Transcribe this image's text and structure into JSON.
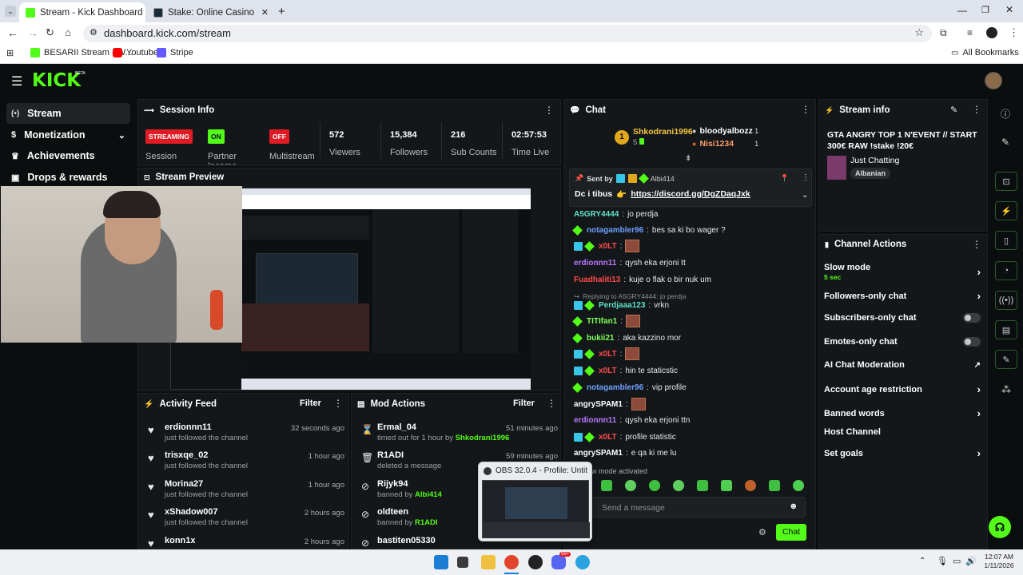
{
  "browser": {
    "tabs": [
      {
        "label": "Stream - Kick Dashboard",
        "active": true
      },
      {
        "label": "Stake: Online Casino & Sports",
        "active": false
      }
    ],
    "url": "dashboard.kick.com/stream",
    "bookmarks": [
      "BESARII Stream - W...",
      "Youtube",
      "Stripe"
    ],
    "all_bookmarks": "All Bookmarks"
  },
  "kick": {
    "logo": "KICK",
    "logo_beta": "BETA",
    "sidebar": [
      {
        "label": "Stream",
        "icon": "broadcast-icon"
      },
      {
        "label": "Monetization",
        "icon": "dollar-icon"
      },
      {
        "label": "Achievements",
        "icon": "trophy-icon"
      },
      {
        "label": "Drops & rewards",
        "icon": "gift-icon"
      }
    ],
    "session": {
      "title": "Session Info",
      "streaming_badge": "STREAMING",
      "session_label": "Session",
      "partner_badge": "ON",
      "partner_label": "Partner Income",
      "multistream_badge": "OFF",
      "multistream_label": "Multistream",
      "viewers": "572",
      "viewers_label": "Viewers",
      "followers": "15,384",
      "followers_label": "Followers",
      "subs": "216",
      "subs_label": "Sub Counts",
      "time": "02:57:53",
      "time_label": "Time Live"
    },
    "preview_title": "Stream Preview",
    "activity": {
      "title": "Activity Feed",
      "filter": "Filter",
      "items": [
        {
          "name": "erdionnn11",
          "sub": "just followed the channel",
          "time": "32 seconds ago"
        },
        {
          "name": "trisxqe_02",
          "sub": "just followed the channel",
          "time": "1 hour ago"
        },
        {
          "name": "Morina27",
          "sub": "just followed the channel",
          "time": "1 hour ago"
        },
        {
          "name": "xShadow007",
          "sub": "just followed the channel",
          "time": "2 hours ago"
        },
        {
          "name": "konn1x",
          "sub": "",
          "time": "2 hours ago"
        }
      ]
    },
    "mod": {
      "title": "Mod Actions",
      "filter": "Filter",
      "items": [
        {
          "name": "Ermal_04",
          "sub": "timed out for 1 hour by",
          "by": "Shkodrani1996",
          "time": "51 minutes ago",
          "icon": "hourglass-icon"
        },
        {
          "name": "R1ADI",
          "sub": "deleted a message",
          "by": "",
          "time": "59 minutes ago",
          "icon": "trash-icon"
        },
        {
          "name": "Rijyk94",
          "sub": "banned by",
          "by": "Albi414",
          "time": "",
          "icon": "ban-icon"
        },
        {
          "name": "oldteen",
          "sub": "banned by",
          "by": "R1ADI",
          "time": "",
          "icon": "ban-icon"
        },
        {
          "name": "bastiten05330",
          "sub": "",
          "by": "",
          "time": "",
          "icon": "ban-icon"
        }
      ]
    },
    "chat": {
      "title": "Chat",
      "leaders": [
        {
          "name": "Shkodrani1996",
          "count": "5",
          "rank": "1"
        },
        {
          "name": "bloodyalbozz",
          "count": "1"
        },
        {
          "name": "Nisi1234",
          "count": "1"
        }
      ],
      "pinned_sent_by": "Sent by",
      "pinned_user": "Albi414",
      "pinned_text": "Dc i tibus",
      "pinned_link": "https://discord.gg/DgZDaqJxk",
      "messages": [
        {
          "user": "A5GRY4444",
          "color": "teal",
          "text": "jo perdja"
        },
        {
          "user": "notagambler96",
          "color": "blue",
          "text": "bes sa ki bo wager ?"
        },
        {
          "user": "x0LT",
          "color": "red",
          "text": "",
          "emote": true
        },
        {
          "user": "erdionnn11",
          "color": "purple",
          "text": "qysh eka erjoni tt"
        },
        {
          "user": "Fuadhaliti13",
          "color": "red",
          "text": "kuje o flak o bir nuk um"
        },
        {
          "user": "Perdjaaa123",
          "color": "teal",
          "text": "vrkn",
          "reply": "Replying to A5GRY4444: jo perdja"
        },
        {
          "user": "TITIfan1",
          "color": "lime",
          "text": "",
          "emote": true
        },
        {
          "user": "bukii21",
          "color": "lime",
          "text": "aka kazzino mor"
        },
        {
          "user": "x0LT",
          "color": "red",
          "text": "",
          "emote": true
        },
        {
          "user": "x0LT",
          "color": "red",
          "text": "hin te staticstic"
        },
        {
          "user": "notagambler96",
          "color": "blue",
          "text": "vip profile"
        },
        {
          "user": "angrySPAM1",
          "color": "white",
          "text": "",
          "emote": true
        },
        {
          "user": "erdionnn11",
          "color": "purple",
          "text": "qysh eka erjoni ttn"
        },
        {
          "user": "x0LT",
          "color": "red",
          "text": "profile statistic"
        },
        {
          "user": "angrySPAM1",
          "color": "white",
          "text": "e qa ki me lu"
        }
      ],
      "slow_mode": "w mode activated",
      "placeholder": "Send a message",
      "send": "Chat"
    },
    "stream_info": {
      "title": "Stream info",
      "stream_title": "GTA ANGRY TOP 1 N'EVENT // START 300€ RAW !stake !20€",
      "category": "Just Chatting",
      "tag": "Albanian"
    },
    "channel_actions": {
      "title": "Channel Actions",
      "slow_mode": "Slow mode",
      "slow_mode_value": "5 sec",
      "items": [
        "Followers-only chat",
        "Subscribers-only chat",
        "Emotes-only chat",
        "AI Chat Moderation",
        "Account age restriction",
        "Banned words",
        "Host Channel",
        "Set goals"
      ]
    }
  },
  "obs_popup": "OBS 32.0.4 - Profile: Untitl...",
  "taskbar": {
    "time": "12:07 AM",
    "date": "1/11/2026",
    "discord_badge": "99+"
  },
  "colors": {
    "kick_green": "#53fc18",
    "panel": "#141719",
    "background": "#0b0e0f",
    "streaming_red": "#e01b24"
  }
}
